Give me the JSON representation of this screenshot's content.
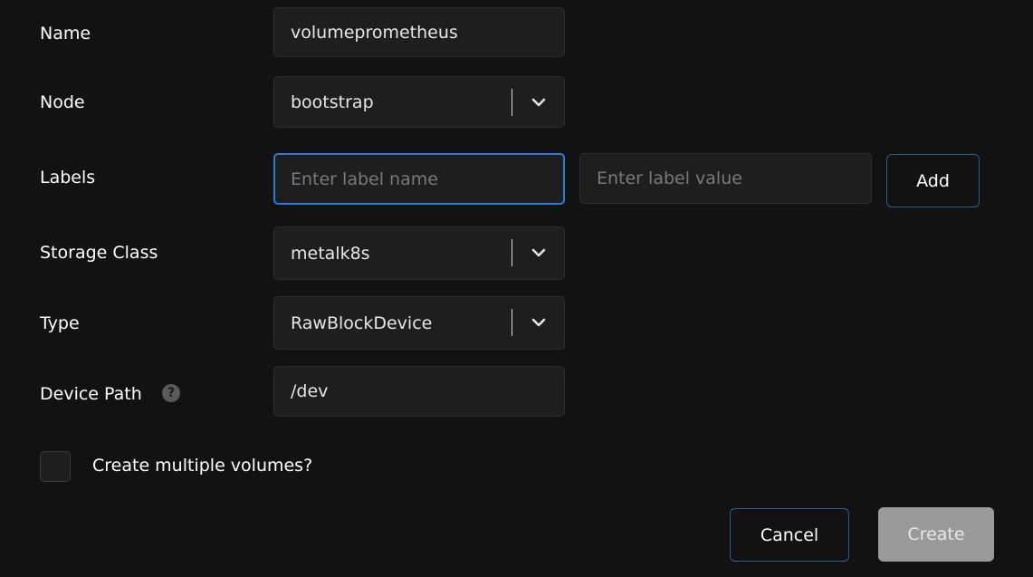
{
  "form": {
    "name": {
      "label": "Name",
      "value": "volumeprometheus"
    },
    "node": {
      "label": "Node",
      "value": "bootstrap"
    },
    "labels": {
      "label": "Labels",
      "name_placeholder": "Enter label name",
      "value_placeholder": "Enter label value",
      "add_label": "Add"
    },
    "storage_class": {
      "label": "Storage Class",
      "value": "metalk8s"
    },
    "type": {
      "label": "Type",
      "value": "RawBlockDevice"
    },
    "device_path": {
      "label": "Device Path",
      "value": "/dev",
      "help_glyph": "?"
    },
    "multiple": {
      "label": "Create multiple volumes?",
      "checked": false
    }
  },
  "actions": {
    "cancel_label": "Cancel",
    "create_label": "Create"
  },
  "colors": {
    "background": "#121212",
    "field_bg": "#1e1e1e",
    "focus_border": "#2d7bd9",
    "button_border": "#2c5f8a",
    "disabled_button": "#9a9a9a"
  }
}
